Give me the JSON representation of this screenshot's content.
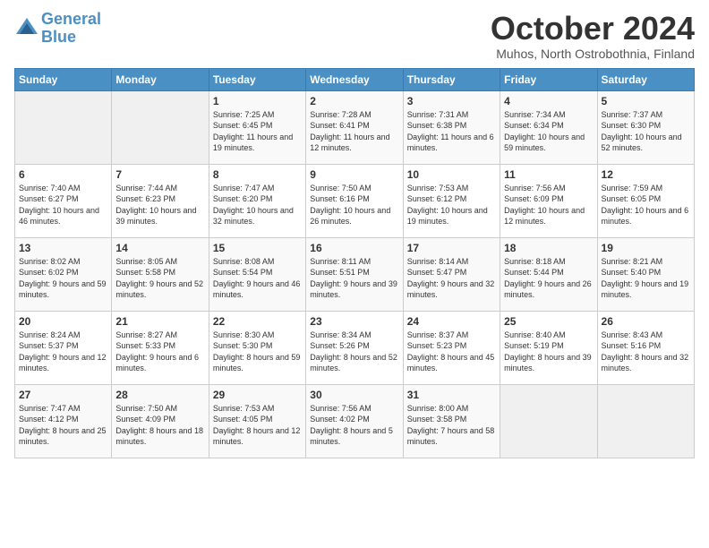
{
  "logo": {
    "line1": "General",
    "line2": "Blue"
  },
  "title": "October 2024",
  "location": "Muhos, North Ostrobothnia, Finland",
  "days_header": [
    "Sunday",
    "Monday",
    "Tuesday",
    "Wednesday",
    "Thursday",
    "Friday",
    "Saturday"
  ],
  "weeks": [
    [
      {
        "num": "",
        "info": ""
      },
      {
        "num": "",
        "info": ""
      },
      {
        "num": "1",
        "info": "Sunrise: 7:25 AM\nSunset: 6:45 PM\nDaylight: 11 hours and 19 minutes."
      },
      {
        "num": "2",
        "info": "Sunrise: 7:28 AM\nSunset: 6:41 PM\nDaylight: 11 hours and 12 minutes."
      },
      {
        "num": "3",
        "info": "Sunrise: 7:31 AM\nSunset: 6:38 PM\nDaylight: 11 hours and 6 minutes."
      },
      {
        "num": "4",
        "info": "Sunrise: 7:34 AM\nSunset: 6:34 PM\nDaylight: 10 hours and 59 minutes."
      },
      {
        "num": "5",
        "info": "Sunrise: 7:37 AM\nSunset: 6:30 PM\nDaylight: 10 hours and 52 minutes."
      }
    ],
    [
      {
        "num": "6",
        "info": "Sunrise: 7:40 AM\nSunset: 6:27 PM\nDaylight: 10 hours and 46 minutes."
      },
      {
        "num": "7",
        "info": "Sunrise: 7:44 AM\nSunset: 6:23 PM\nDaylight: 10 hours and 39 minutes."
      },
      {
        "num": "8",
        "info": "Sunrise: 7:47 AM\nSunset: 6:20 PM\nDaylight: 10 hours and 32 minutes."
      },
      {
        "num": "9",
        "info": "Sunrise: 7:50 AM\nSunset: 6:16 PM\nDaylight: 10 hours and 26 minutes."
      },
      {
        "num": "10",
        "info": "Sunrise: 7:53 AM\nSunset: 6:12 PM\nDaylight: 10 hours and 19 minutes."
      },
      {
        "num": "11",
        "info": "Sunrise: 7:56 AM\nSunset: 6:09 PM\nDaylight: 10 hours and 12 minutes."
      },
      {
        "num": "12",
        "info": "Sunrise: 7:59 AM\nSunset: 6:05 PM\nDaylight: 10 hours and 6 minutes."
      }
    ],
    [
      {
        "num": "13",
        "info": "Sunrise: 8:02 AM\nSunset: 6:02 PM\nDaylight: 9 hours and 59 minutes."
      },
      {
        "num": "14",
        "info": "Sunrise: 8:05 AM\nSunset: 5:58 PM\nDaylight: 9 hours and 52 minutes."
      },
      {
        "num": "15",
        "info": "Sunrise: 8:08 AM\nSunset: 5:54 PM\nDaylight: 9 hours and 46 minutes."
      },
      {
        "num": "16",
        "info": "Sunrise: 8:11 AM\nSunset: 5:51 PM\nDaylight: 9 hours and 39 minutes."
      },
      {
        "num": "17",
        "info": "Sunrise: 8:14 AM\nSunset: 5:47 PM\nDaylight: 9 hours and 32 minutes."
      },
      {
        "num": "18",
        "info": "Sunrise: 8:18 AM\nSunset: 5:44 PM\nDaylight: 9 hours and 26 minutes."
      },
      {
        "num": "19",
        "info": "Sunrise: 8:21 AM\nSunset: 5:40 PM\nDaylight: 9 hours and 19 minutes."
      }
    ],
    [
      {
        "num": "20",
        "info": "Sunrise: 8:24 AM\nSunset: 5:37 PM\nDaylight: 9 hours and 12 minutes."
      },
      {
        "num": "21",
        "info": "Sunrise: 8:27 AM\nSunset: 5:33 PM\nDaylight: 9 hours and 6 minutes."
      },
      {
        "num": "22",
        "info": "Sunrise: 8:30 AM\nSunset: 5:30 PM\nDaylight: 8 hours and 59 minutes."
      },
      {
        "num": "23",
        "info": "Sunrise: 8:34 AM\nSunset: 5:26 PM\nDaylight: 8 hours and 52 minutes."
      },
      {
        "num": "24",
        "info": "Sunrise: 8:37 AM\nSunset: 5:23 PM\nDaylight: 8 hours and 45 minutes."
      },
      {
        "num": "25",
        "info": "Sunrise: 8:40 AM\nSunset: 5:19 PM\nDaylight: 8 hours and 39 minutes."
      },
      {
        "num": "26",
        "info": "Sunrise: 8:43 AM\nSunset: 5:16 PM\nDaylight: 8 hours and 32 minutes."
      }
    ],
    [
      {
        "num": "27",
        "info": "Sunrise: 7:47 AM\nSunset: 4:12 PM\nDaylight: 8 hours and 25 minutes."
      },
      {
        "num": "28",
        "info": "Sunrise: 7:50 AM\nSunset: 4:09 PM\nDaylight: 8 hours and 18 minutes."
      },
      {
        "num": "29",
        "info": "Sunrise: 7:53 AM\nSunset: 4:05 PM\nDaylight: 8 hours and 12 minutes."
      },
      {
        "num": "30",
        "info": "Sunrise: 7:56 AM\nSunset: 4:02 PM\nDaylight: 8 hours and 5 minutes."
      },
      {
        "num": "31",
        "info": "Sunrise: 8:00 AM\nSunset: 3:58 PM\nDaylight: 7 hours and 58 minutes."
      },
      {
        "num": "",
        "info": ""
      },
      {
        "num": "",
        "info": ""
      }
    ]
  ]
}
